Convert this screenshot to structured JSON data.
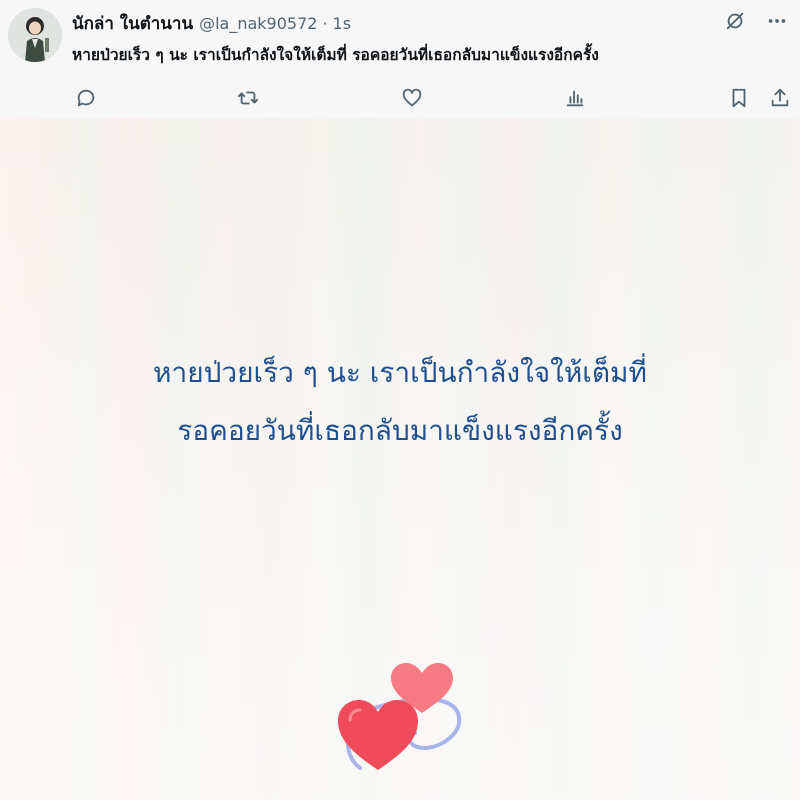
{
  "post": {
    "display_name": "นักล่า ในตำนาน",
    "handle": "@la_nak90572",
    "separator": "·",
    "time": "1s",
    "text": "หายป่วยเร็ว ๆ นะ เราเป็นกำลังใจให้เต็มที่ รอคอยวันที่เธอกลับมาแข็งแรงอีกครั้ง"
  },
  "card": {
    "line1": "หายป่วยเร็ว ๆ นะ เราเป็นกำลังใจให้เต็มที่",
    "line2": "รอคอยวันที่เธอกลับมาแข็งแรงอีกครั้ง",
    "text_color": "#1e4f8f"
  },
  "icons": {
    "top": [
      "grok-icon",
      "more-icon"
    ],
    "actions": [
      "reply-icon",
      "repost-icon",
      "like-icon",
      "views-icon",
      "bookmark-icon",
      "share-icon"
    ]
  },
  "colors": {
    "text": "#0f1419",
    "muted": "#536471",
    "heart_front": "#f04b5b",
    "heart_back": "#f77b84",
    "swirl": "#a9b4e8"
  }
}
